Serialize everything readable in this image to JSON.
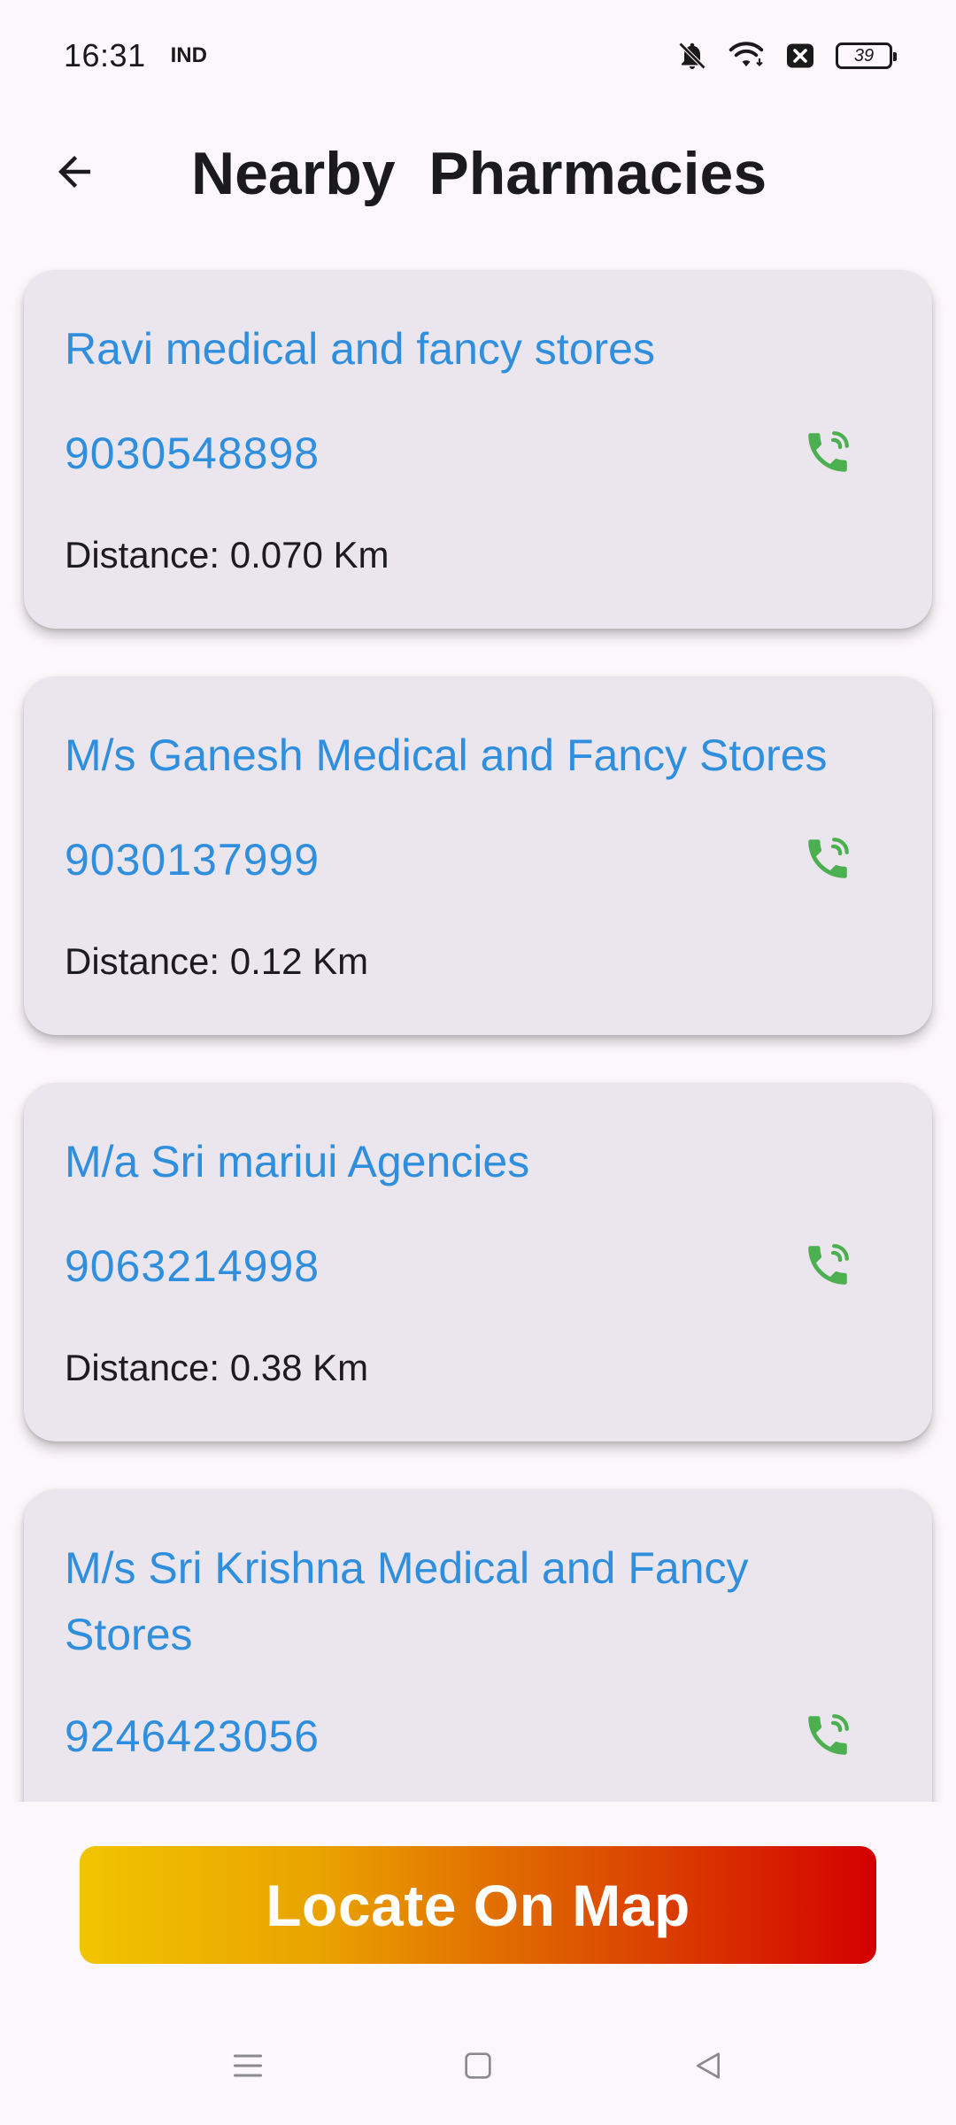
{
  "status_bar": {
    "time": "16:31",
    "carrier": "IND",
    "battery": "39",
    "icons": [
      "bell-off-icon",
      "wifi-icon",
      "close-box-icon",
      "battery-icon"
    ]
  },
  "app_bar": {
    "title": "Nearby  Pharmacies",
    "back_icon": "arrow-left-icon"
  },
  "pharmacies": [
    {
      "name": "Ravi medical and fancy stores",
      "phone": "9030548898",
      "distance": "Distance: 0.070 Km"
    },
    {
      "name": "M/s Ganesh Medical and Fancy Stores",
      "phone": "9030137999",
      "distance": "Distance: 0.12 Km"
    },
    {
      "name": "M/a Sri mariui Agencies",
      "phone": "9063214998",
      "distance": "Distance: 0.38 Km"
    },
    {
      "name": "M/s Sri Krishna Medical and Fancy Stores",
      "phone": "9246423056",
      "distance": ""
    }
  ],
  "locate_button": {
    "label": "Locate On Map"
  },
  "colors": {
    "link_blue": "#2f8fde",
    "call_green": "#4caf50",
    "card_bg": "#ebe6ee",
    "gradient_start": "#f0c400",
    "gradient_end": "#d30000"
  },
  "nav_bar": {
    "icons": [
      "menu-icon",
      "home-square-icon",
      "back-triangle-icon"
    ]
  }
}
